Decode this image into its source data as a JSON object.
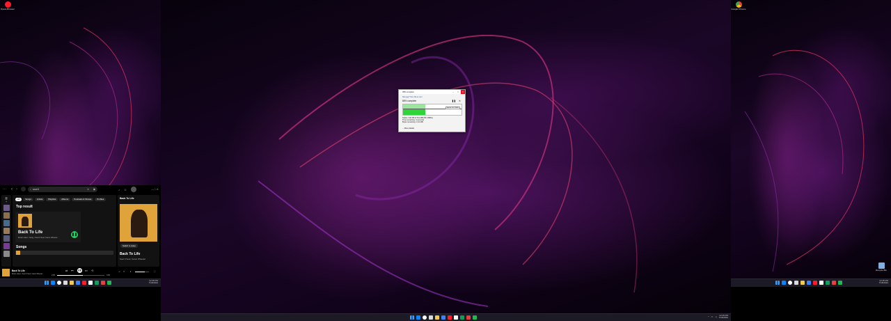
{
  "desktop_left": {
    "icons": [
      {
        "label": "Opera Browser",
        "icon": "opera-icon",
        "color": "#ff1b2d"
      }
    ]
  },
  "desktop_right": {
    "icons": [
      {
        "label": "Google Chrome",
        "icon": "chrome-icon",
        "color": "#4285f4"
      },
      {
        "label": "Recycle Bin",
        "icon": "recycle-bin-icon",
        "color": "#7fb0e0"
      }
    ]
  },
  "spotify": {
    "search_value": "soul ll",
    "filters": [
      "All",
      "Songs",
      "Artists",
      "Playlists",
      "Albums",
      "Podcasts & Shows",
      "Profiles"
    ],
    "top_result_heading": "Top result",
    "top_result_title": "Back To Life",
    "top_result_meta": "Music video • Song • Soul II Soul, Caron Wheeler",
    "songs_heading": "Songs",
    "now_playing_panel_title": "Back To Life",
    "switch_to_video_label": "Switch to video",
    "now_playing_title": "Back To Life",
    "now_playing_artist": "Soul II Soul, Caron Wheeler",
    "player_title": "Back To Life",
    "player_meta": "Music video • Soul II Soul, Caron Wheeler",
    "elapsed": "2:05",
    "duration": "3:50",
    "progress_fraction": 0.54,
    "volume_fraction": 0.7,
    "accent": "#1ed760",
    "cover_color": "#e0a33a"
  },
  "download_dialog": {
    "title": "85% complete",
    "source_line": "filen.jpg? from file.io.com",
    "percent_text": "85% complete",
    "progress_fraction": 0.85,
    "pause_label": "Pause",
    "cancel_label": "Cancel",
    "info_lines": [
      "Status: 444 KB of 511 MB (56.3 MB/s)",
      "Time remaining: 4 seconds",
      "Bytes remaining: 3.41 MB"
    ],
    "checkbox_label": "More details",
    "chart_color": "#2fd33a"
  },
  "taskbar": {
    "left_time": "12:45 PM",
    "left_date": "7/18/2024",
    "center_time": "12:45 PM",
    "center_date": "7/18/2024",
    "right_time": "12:45 PM",
    "right_date": "7/18/2024",
    "icon_colors": [
      "#0a84ff",
      "#ffffff",
      "#d9d9d9",
      "#f2c94c",
      "#3b82f6",
      "#ff1b2d",
      "#ffffff",
      "#0f9d58",
      "#e83e3e",
      "#1db954"
    ]
  }
}
